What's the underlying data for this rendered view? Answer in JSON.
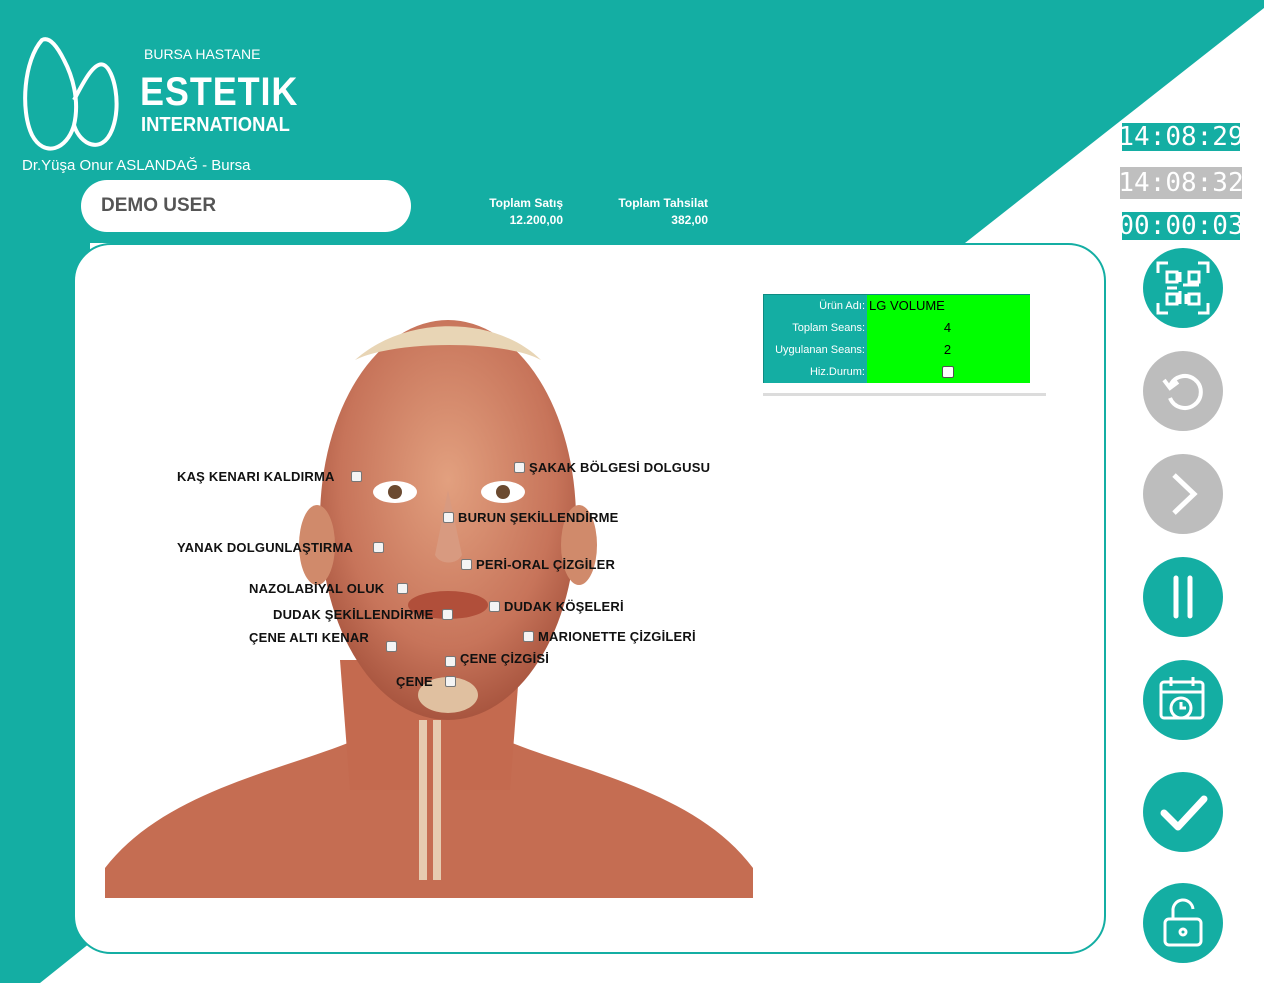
{
  "brand": {
    "sub": "BURSA HASTANE",
    "main": "ESTETIK",
    "main2": "INTERNATIONAL",
    "doctor": "Dr.Yüşa Onur ASLANDAĞ - Bursa"
  },
  "user": {
    "name": "DEMO USER"
  },
  "stats": {
    "sales_label": "Toplam Satış",
    "sales_value": "12.200,00",
    "collection_label": "Toplam Tahsilat",
    "collection_value": "382,00"
  },
  "clocks": {
    "clock1": "14:08:29",
    "clock2": "14:08:32",
    "clock3": "00:00:03"
  },
  "product_info": {
    "product_label": "Ürün Adı:",
    "product_value": "LG VOLUME",
    "total_sessions_label": "Toplam Seans:",
    "total_sessions_value": "4",
    "applied_sessions_label": "Uygulanan Seans:",
    "applied_sessions_value": "2",
    "speed_label": "Hiz.Durum:"
  },
  "regions": [
    "KAŞ KENARI KALDIRMA",
    "ŞAKAK BÖLGESİ DOLGUSU",
    "BURUN ŞEKİLLENDİRME",
    "YANAK DOLGUNLAŞTIRMA",
    "PERİ-ORAL ÇİZGİLER",
    "NAZOLABİYAL OLUK",
    "DUDAK KÖŞELERİ",
    "DUDAK ŞEKİLLENDİRME",
    "MARIONETTE ÇİZGİLERİ",
    "ÇENE ALTI KENAR",
    "ÇENE ÇİZGİSİ",
    "ÇENE"
  ],
  "colors": {
    "accent": "#14aea3",
    "status_green": "#00ff00",
    "disabled": "#bdbdbd"
  },
  "icons": [
    "qr-code-icon",
    "undo-icon",
    "next-icon",
    "pause-icon",
    "calendar-clock-icon",
    "check-icon",
    "unlock-icon"
  ]
}
